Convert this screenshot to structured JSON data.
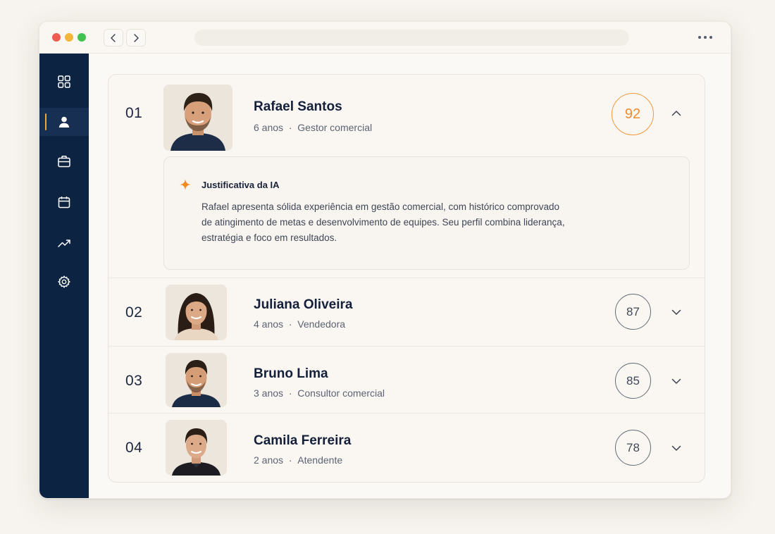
{
  "sidebar": {
    "items": [
      {
        "icon": "grid-icon"
      },
      {
        "icon": "user-icon",
        "active": true
      },
      {
        "icon": "briefcase-icon"
      },
      {
        "icon": "calendar-icon"
      },
      {
        "icon": "trending-up-icon"
      },
      {
        "icon": "gear-icon"
      }
    ]
  },
  "colors": {
    "sidebar": "#0d2342",
    "accent": "#f08a2c",
    "active_indicator": "#f2a33a"
  },
  "candidates": [
    {
      "rank": "01",
      "name": "Rafael Santos",
      "years": "6 anos",
      "role": "Gestor comercial",
      "score": "92",
      "expanded": true,
      "justification": {
        "title": "Justificativa da IA",
        "text": "Rafael apresenta sólida experiência em gestão comercial, com histórico comprovado de atingimento de metas e desenvolvimento de equipes. Seu perfil combina liderança, estratégia e foco em resultados."
      }
    },
    {
      "rank": "02",
      "name": "Juliana Oliveira",
      "years": "4 anos",
      "role": "Vendedora",
      "score": "87",
      "expanded": false
    },
    {
      "rank": "03",
      "name": "Bruno Lima",
      "years": "3 anos",
      "role": "Consultor comercial",
      "score": "85",
      "expanded": false
    },
    {
      "rank": "04",
      "name": "Camila Ferreira",
      "years": "2 anos",
      "role": "Atendente",
      "score": "78",
      "expanded": false
    }
  ],
  "separator": "·"
}
